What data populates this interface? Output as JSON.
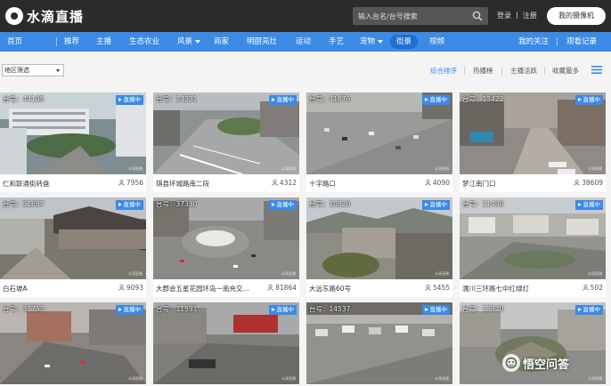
{
  "brand": {
    "name": "水滴直播"
  },
  "search": {
    "placeholder": "输入台名/台号搜索"
  },
  "top_links": {
    "login": "登录",
    "sep": "|",
    "register": "注册"
  },
  "my_camera_label": "我的摄像机",
  "nav": {
    "items": [
      {
        "label": "首页"
      },
      {
        "label": "推荐"
      },
      {
        "label": "主播"
      },
      {
        "label": "生态农业"
      },
      {
        "label": "风景"
      },
      {
        "label": "商家"
      },
      {
        "label": "明厨亮灶"
      },
      {
        "label": "运动"
      },
      {
        "label": "手艺"
      },
      {
        "label": "宠物"
      },
      {
        "label": "街景"
      },
      {
        "label": "视频"
      }
    ],
    "right": [
      {
        "label": "我的关注"
      },
      {
        "label": "观看记录"
      }
    ],
    "active": "街景"
  },
  "filter": {
    "region_selected": "地区筛选",
    "sort_options": [
      "综合排序",
      "热播榜",
      "主播活跃",
      "收藏最多"
    ]
  },
  "cards": [
    {
      "room": "台号：44105",
      "title": "仁和联通街转盘",
      "viewers": "7956",
      "live": "直播中"
    },
    {
      "room": "台号：14231",
      "title": "琪县环城路南二段",
      "viewers": "4312",
      "live": "直播中"
    },
    {
      "room": "台号：41876",
      "title": "十字路口",
      "viewers": "4090",
      "live": "直播中"
    },
    {
      "room": "台号：13422",
      "title": "梦江南门口",
      "viewers": "38609",
      "live": "直播中"
    },
    {
      "room": "台号：51687",
      "title": "白石坡A",
      "viewers": "9093",
      "live": "直播中"
    },
    {
      "room": "台号：37330",
      "title": "大郡会五星花园环岛一南充交...",
      "viewers": "81864",
      "live": "直播中"
    },
    {
      "room": "台号：10329",
      "title": "大远东路60号",
      "viewers": "5455",
      "live": "直播中"
    },
    {
      "room": "台号：11498",
      "title": "濡川三环路七中红绿灯",
      "viewers": "502",
      "live": "直播中"
    },
    {
      "room": "台号：37753",
      "title": "",
      "viewers": "",
      "live": "直播中"
    },
    {
      "room": "台号：11591",
      "title": "",
      "viewers": "",
      "live": "直播中"
    },
    {
      "room": "台号：14537",
      "title": "",
      "viewers": "",
      "live": "直播中"
    },
    {
      "room": "台号：12340",
      "title": "",
      "viewers": "",
      "live": "直播中"
    }
  ],
  "thumb_watermark": "水滴直播",
  "watermark": {
    "text": "悟空问答"
  },
  "colors": {
    "accent": "#3b8ae6",
    "topbar": "#2b2b2b",
    "nav_active": "#1f6fd0"
  }
}
